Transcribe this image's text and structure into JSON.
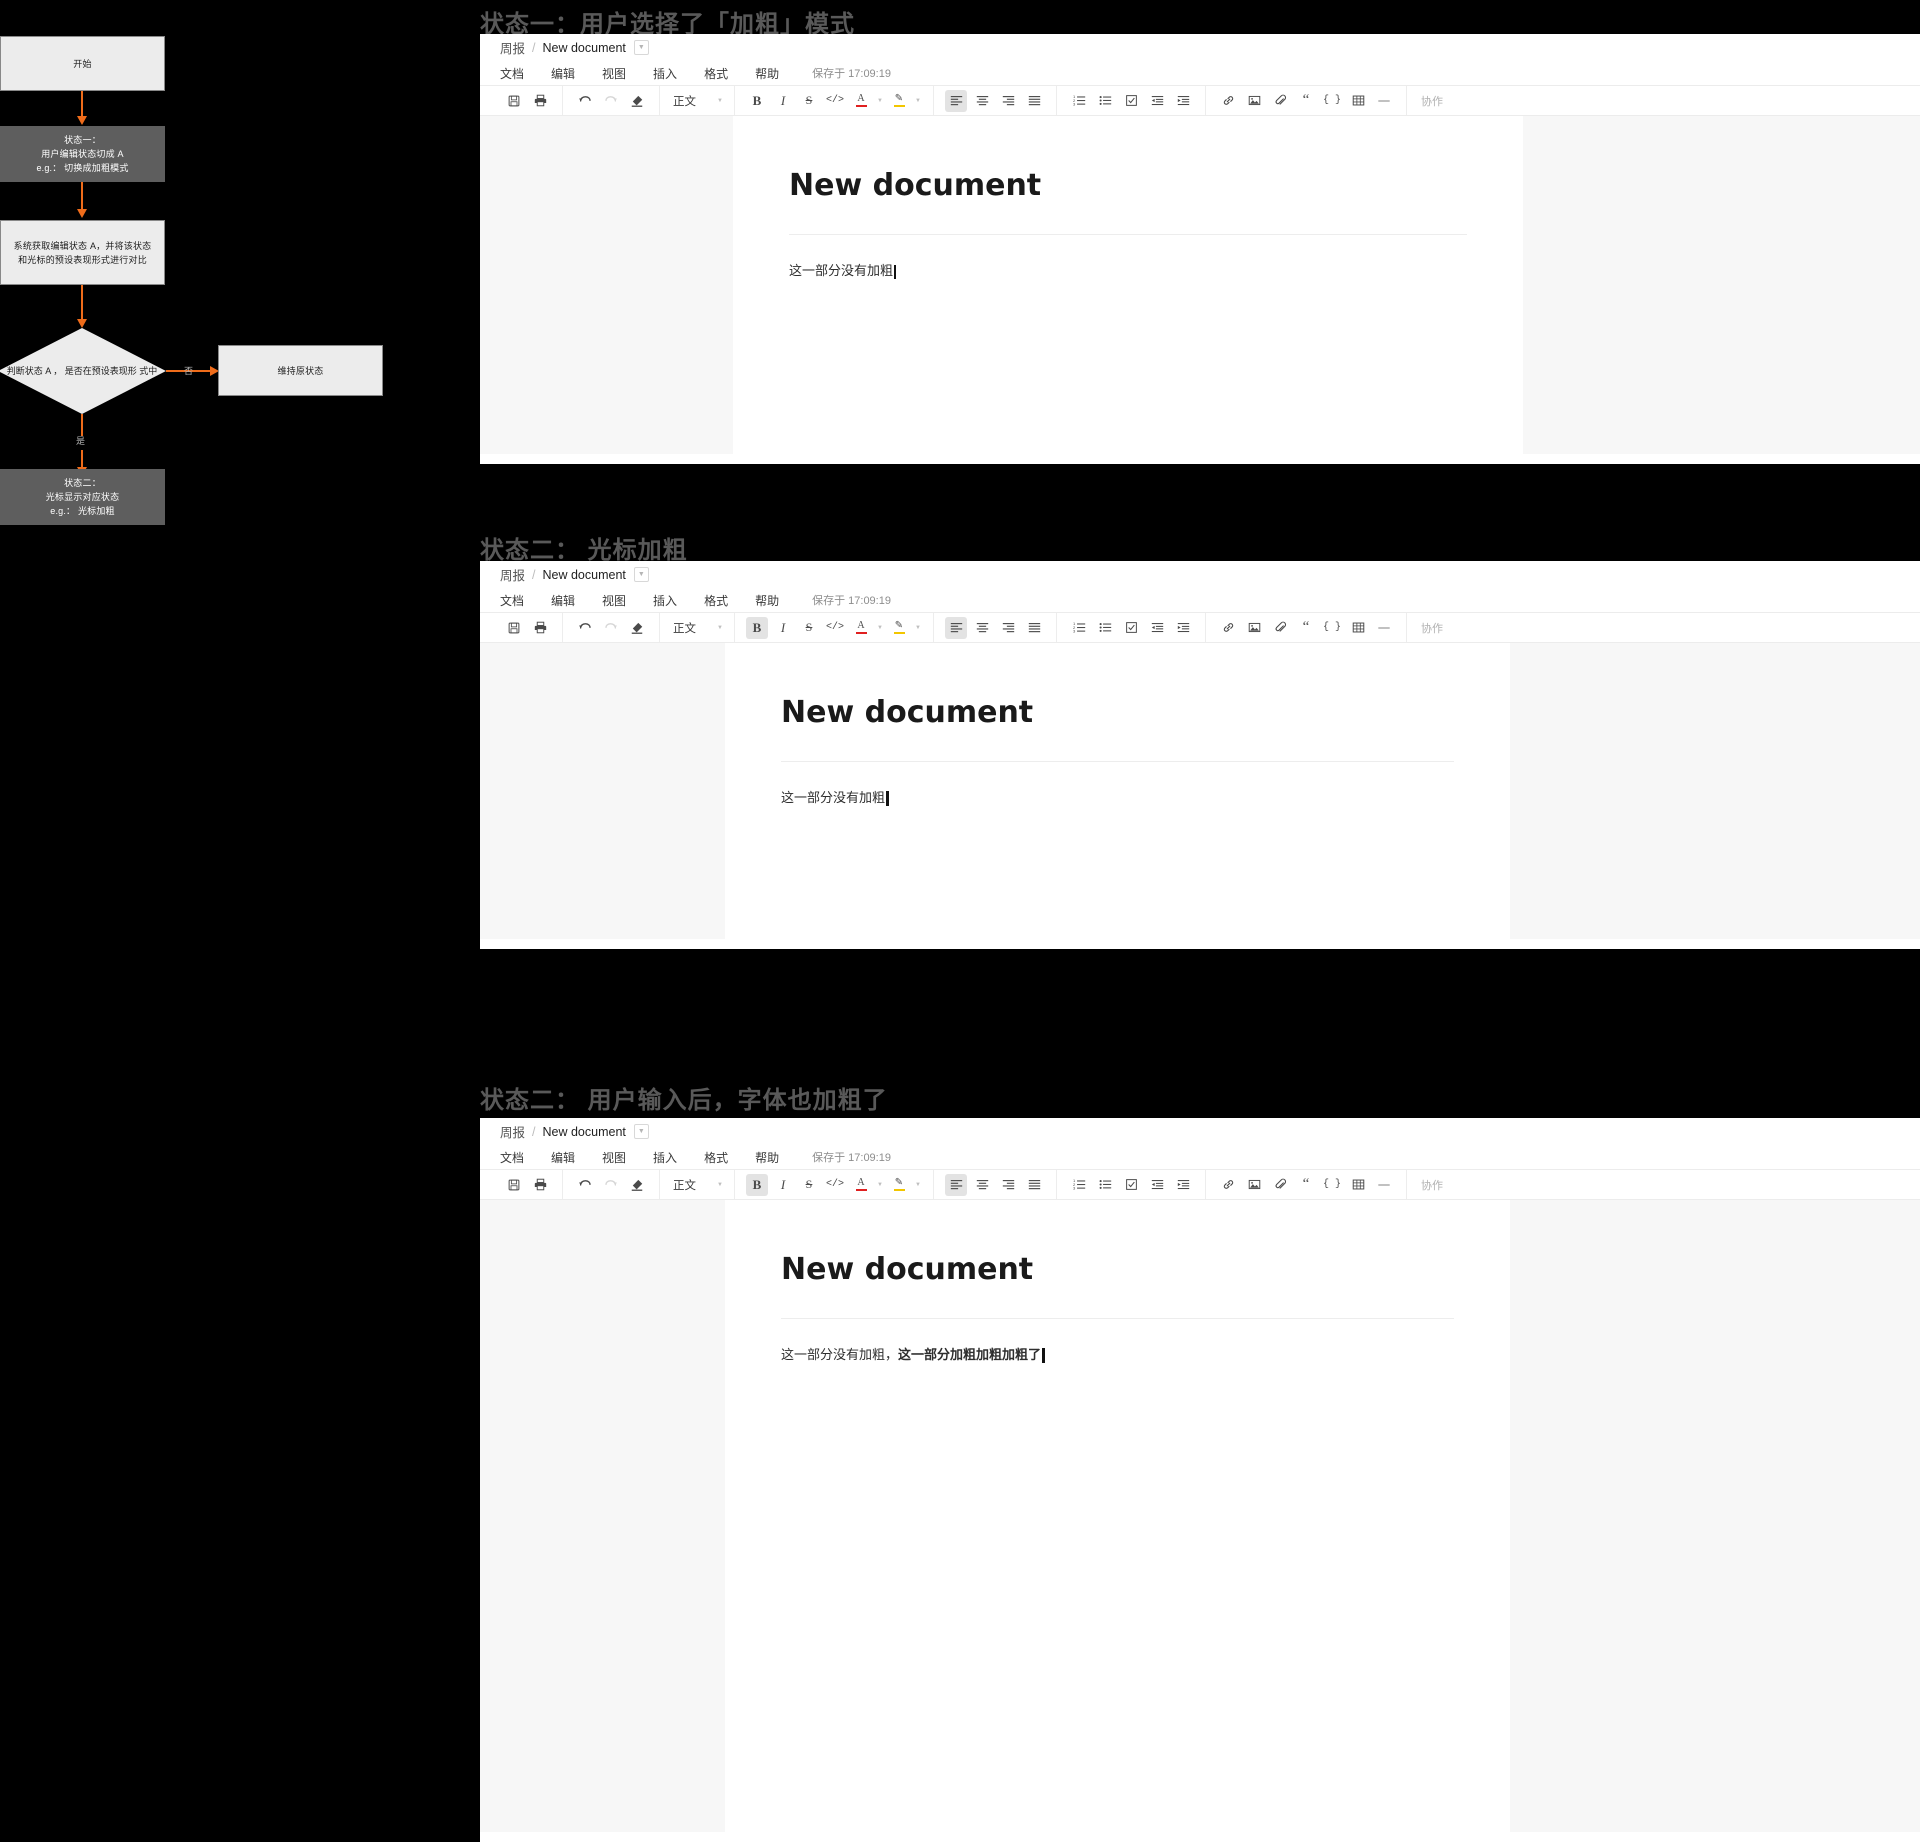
{
  "flowchart": {
    "nodes": [
      {
        "id": "start",
        "lines": [
          "开始"
        ],
        "style": "light"
      },
      {
        "id": "state-one",
        "lines": [
          "状态一：",
          "用户编辑状态切成 A",
          "e.g.： 切换成加粗模式"
        ],
        "style": "dark"
      },
      {
        "id": "system-compare",
        "lines": [
          "系统获取编辑状态 A，并将该状态",
          "和光标的预设表现形式进行对比"
        ],
        "style": "light"
      },
      {
        "id": "decision",
        "lines": [
          "判断状态 A ， 是否在预设表现形",
          "式中"
        ],
        "style": "diamond"
      },
      {
        "id": "keep-state",
        "lines": [
          "维持原状态"
        ],
        "style": "light"
      },
      {
        "id": "state-two",
        "lines": [
          "状态二：",
          "光标显示对应状态",
          "e.g.： 光标加粗"
        ],
        "style": "dark"
      }
    ],
    "edge_labels": {
      "no": "否",
      "yes": "是"
    },
    "arrow_color": "#ef6c1a"
  },
  "sections": [
    {
      "caption": "状态一：用户选择了「加粗」模式"
    },
    {
      "caption": "状态二： 光标加粗"
    },
    {
      "caption": "状态二： 用户输入后，字体也加粗了"
    }
  ],
  "editor": {
    "breadcrumb": {
      "root": "周报",
      "separator": "/",
      "current": "New document"
    },
    "caret_icon": "chevron-down-icon",
    "menu": [
      "文档",
      "编辑",
      "视图",
      "插入",
      "格式",
      "帮助"
    ],
    "saved_status": "保存于 17:09:19",
    "toolbar": {
      "groups": [
        {
          "name": "file",
          "items": [
            {
              "icon": "save-icon",
              "glyph": "ὋE"
            },
            {
              "icon": "print-icon",
              "glyph": "print"
            }
          ]
        },
        {
          "name": "history",
          "items": [
            {
              "icon": "undo-icon",
              "glyph": "undo"
            },
            {
              "icon": "redo-icon",
              "glyph": "redo"
            },
            {
              "icon": "clear-format-icon",
              "glyph": "eraser"
            }
          ]
        },
        {
          "name": "paragraph-style",
          "items": [
            {
              "icon": "style-select",
              "label": "正文"
            }
          ]
        },
        {
          "name": "text-format",
          "items": [
            {
              "icon": "bold-icon",
              "glyph": "B"
            },
            {
              "icon": "italic-icon",
              "glyph": "I"
            },
            {
              "icon": "strikethrough-icon",
              "glyph": "S"
            },
            {
              "icon": "inline-code-icon",
              "glyph": "</>"
            },
            {
              "icon": "font-color-icon",
              "glyph": "A"
            },
            {
              "icon": "highlight-color-icon",
              "glyph": "pen"
            }
          ]
        },
        {
          "name": "alignment",
          "items": [
            {
              "icon": "align-left-icon"
            },
            {
              "icon": "align-center-icon"
            },
            {
              "icon": "align-right-icon"
            },
            {
              "icon": "align-justify-icon"
            }
          ]
        },
        {
          "name": "lists",
          "items": [
            {
              "icon": "ordered-list-icon"
            },
            {
              "icon": "bulleted-list-icon"
            },
            {
              "icon": "checklist-icon"
            },
            {
              "icon": "outdent-icon"
            },
            {
              "icon": "indent-icon"
            }
          ]
        },
        {
          "name": "insert",
          "items": [
            {
              "icon": "link-icon"
            },
            {
              "icon": "image-icon"
            },
            {
              "icon": "attachment-icon"
            },
            {
              "icon": "quote-icon"
            },
            {
              "icon": "code-block-icon"
            },
            {
              "icon": "table-icon"
            },
            {
              "icon": "horizontal-rule-icon"
            }
          ]
        }
      ],
      "collab_label": "协作",
      "style_label": "正文",
      "font_color": "#e02020",
      "highlight_color": "#f2c600"
    },
    "document": {
      "title": "New document",
      "paragraph_plain": "这一部分没有加粗",
      "paragraph_mixed_plain": "这一部分没有加粗，",
      "paragraph_mixed_bold": "这一部分加粗加粗加粗了"
    }
  },
  "states": {
    "one": {
      "bold_active": false,
      "caret_bold": false,
      "body": "plain"
    },
    "two": {
      "bold_active": true,
      "caret_bold": true,
      "body": "plain"
    },
    "three": {
      "bold_active": true,
      "caret_bold": true,
      "body": "mixed"
    }
  }
}
